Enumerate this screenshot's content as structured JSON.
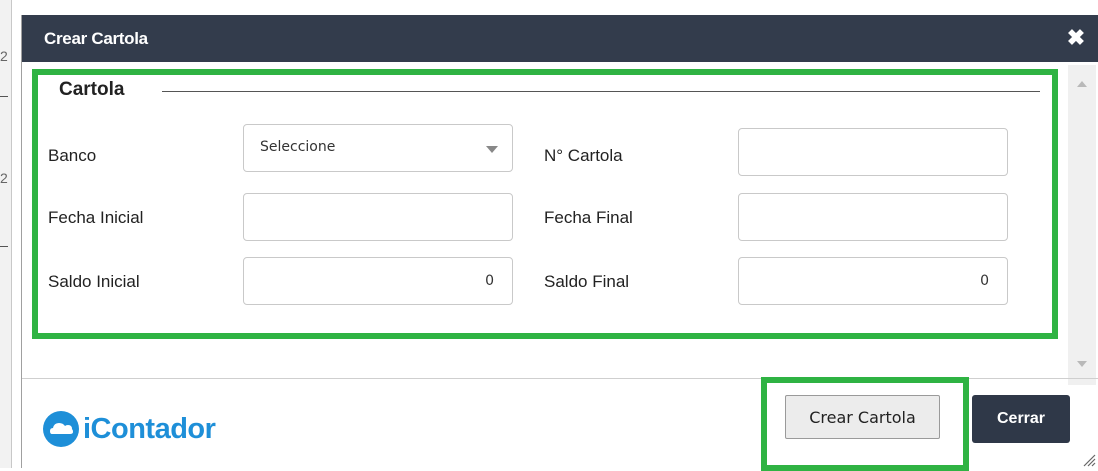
{
  "background": {
    "digits": [
      "2",
      "2"
    ]
  },
  "dialog": {
    "title": "Crear Cartola",
    "close_icon": "close-icon",
    "fieldset": {
      "legend": "Cartola",
      "fields": {
        "banco": {
          "label": "Banco",
          "value": "Seleccione"
        },
        "num_cartola": {
          "label": "N° Cartola",
          "value": ""
        },
        "fecha_inicial": {
          "label": "Fecha Inicial",
          "value": ""
        },
        "fecha_final": {
          "label": "Fecha Final",
          "value": ""
        },
        "saldo_inicial": {
          "label": "Saldo Inicial",
          "value": "0"
        },
        "saldo_final": {
          "label": "Saldo Final",
          "value": "0"
        }
      }
    },
    "footer": {
      "logo_text": "iContador",
      "create_button": "Crear Cartola",
      "close_button": "Cerrar"
    }
  },
  "colors": {
    "titlebar": "#333c4c",
    "highlight": "#2fb343",
    "logo": "#1e8fd8",
    "close_button": "#2f3848"
  }
}
